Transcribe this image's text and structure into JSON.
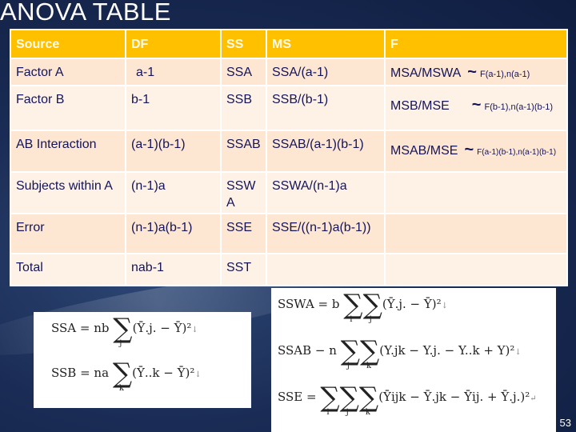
{
  "slide": {
    "title": "ANOVA TABLE",
    "page_number": "53"
  },
  "table": {
    "headers": [
      "Source",
      "DF",
      "SS",
      "MS",
      "F"
    ],
    "rows": [
      {
        "source": "Factor A",
        "df": "a-1",
        "ss": "SSA",
        "ms": "SSA/(a-1)",
        "f_main": "MSA/MSWA",
        "f_tilde": "~",
        "f_sub": "F(a-1),n(a-1)"
      },
      {
        "source": "Factor B",
        "df": "b-1",
        "ss": "SSB",
        "ms": "SSB/(b-1)",
        "f_main": "MSB/MSE",
        "f_tilde": "~",
        "f_sub": "F(b-1),n(a-1)(b-1)"
      },
      {
        "source": "AB Interaction",
        "df": "(a-1)(b-1)",
        "ss": "SSAB",
        "ms": "SSAB/(a-1)(b-1)",
        "f_main": "MSAB/MSE",
        "f_tilde": "~",
        "f_sub": "F(a-1)(b-1),n(a-1)(b-1)"
      },
      {
        "source": "Subjects within A",
        "df": "(n-1)a",
        "ss": "SSWA",
        "ms": "SSWA/(n-1)a",
        "f_main": "",
        "f_tilde": "",
        "f_sub": ""
      },
      {
        "source": "Error",
        "df": "(n-1)a(b-1)",
        "ss": "SSE",
        "ms": "SSE/((n-1)a(b-1))",
        "f_main": "",
        "f_tilde": "",
        "f_sub": ""
      },
      {
        "source": "Total",
        "df": "nab-1",
        "ss": "SST",
        "ms": "",
        "f_main": "",
        "f_tilde": "",
        "f_sub": ""
      }
    ]
  },
  "formulas_left": [
    {
      "lhs": "SSA = nb",
      "sums": [
        "j"
      ],
      "term": "(Ȳ.j. − Ȳ)²"
    },
    {
      "lhs": "SSB = na",
      "sums": [
        "k"
      ],
      "term": "(Ȳ..k − Ȳ)²"
    }
  ],
  "formulas_right": [
    {
      "lhs": "SSWA = b",
      "sums": [
        "i",
        "j"
      ],
      "term": "(Ȳ.j. − Ȳ)²"
    },
    {
      "lhs": "SSAB − n",
      "sums": [
        "j",
        "k"
      ],
      "term": "(Y.jk − Y.j. − Y..k + Y)²"
    },
    {
      "lhs": "SSE =",
      "sums": [
        "i",
        "j",
        "k"
      ],
      "term": "(Ȳijk − Ȳ.jk − Ȳij. + Ȳ.j.)²"
    }
  ]
}
